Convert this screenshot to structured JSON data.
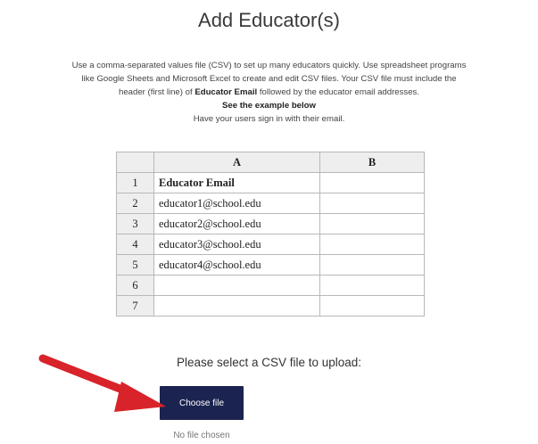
{
  "page": {
    "title": "Add Educator(s)"
  },
  "description": {
    "line1": "Use a comma-separated values file (CSV) to set up many educators quickly. Use spreadsheet programs",
    "line2": "like Google Sheets and Microsoft Excel to create and edit CSV files. Your CSV file must include the",
    "line3_pre": "header (first line) of ",
    "line3_bold": "Educator Email",
    "line3_post": " followed by the educator email addresses.",
    "example_note": "See the example below",
    "signin_note": "Have your users sign in with their email."
  },
  "example_sheet": {
    "columns": [
      "A",
      "B"
    ],
    "rows": [
      {
        "num": "1",
        "a": "Educator Email",
        "b": ""
      },
      {
        "num": "2",
        "a": "educator1@school.edu",
        "b": ""
      },
      {
        "num": "3",
        "a": "educator2@school.edu",
        "b": ""
      },
      {
        "num": "4",
        "a": "educator3@school.edu",
        "b": ""
      },
      {
        "num": "5",
        "a": "educator4@school.edu",
        "b": ""
      },
      {
        "num": "6",
        "a": "",
        "b": ""
      },
      {
        "num": "7",
        "a": "",
        "b": ""
      }
    ]
  },
  "upload": {
    "prompt": "Please select a CSV file to upload:",
    "button_label": "Choose file",
    "status": "No file chosen"
  },
  "colors": {
    "button_bg": "#1b2450",
    "arrow": "#d8232a"
  }
}
